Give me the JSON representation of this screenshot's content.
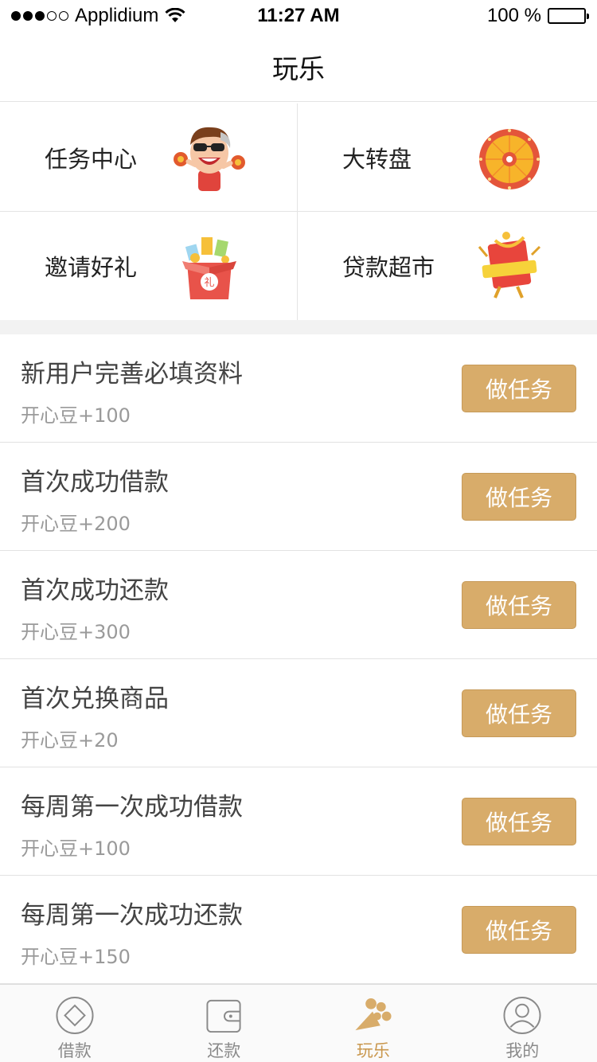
{
  "status_bar": {
    "carrier": "Applidium",
    "time": "11:27 AM",
    "battery": "100 %"
  },
  "nav": {
    "title": "玩乐"
  },
  "grid": [
    {
      "label": "任务中心",
      "icon": "cartoon-man-icon"
    },
    {
      "label": "大转盘",
      "icon": "prize-wheel-icon"
    },
    {
      "label": "邀请好礼",
      "icon": "gift-box-icon"
    },
    {
      "label": "贷款超市",
      "icon": "red-envelope-icon"
    }
  ],
  "tasks": [
    {
      "title": "新用户完善必填资料",
      "reward": "开心豆+100",
      "button": "做任务"
    },
    {
      "title": "首次成功借款",
      "reward": "开心豆+200",
      "button": "做任务"
    },
    {
      "title": "首次成功还款",
      "reward": "开心豆+300",
      "button": "做任务"
    },
    {
      "title": "首次兑换商品",
      "reward": "开心豆+20",
      "button": "做任务"
    },
    {
      "title": "每周第一次成功借款",
      "reward": "开心豆+100",
      "button": "做任务"
    },
    {
      "title": "每周第一次成功还款",
      "reward": "开心豆+150",
      "button": "做任务"
    }
  ],
  "tabs": [
    {
      "label": "借款",
      "icon": "diamond-circle-icon",
      "active": false
    },
    {
      "label": "还款",
      "icon": "wallet-icon",
      "active": false
    },
    {
      "label": "玩乐",
      "icon": "popcorn-icon",
      "active": true
    },
    {
      "label": "我的",
      "icon": "profile-icon",
      "active": false
    }
  ],
  "colors": {
    "accent": "#d8ac6a",
    "accent_text": "#c9974d",
    "divider": "#e4e4e4"
  }
}
